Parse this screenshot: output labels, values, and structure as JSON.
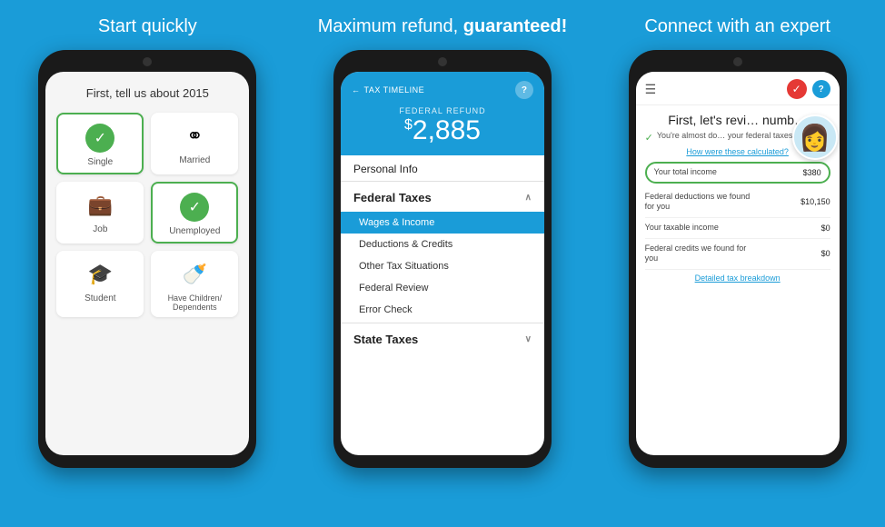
{
  "columns": [
    {
      "id": "col1",
      "title_plain": "Start quickly",
      "title_bold": "",
      "phone": {
        "header_text": "First, tell us about 2015",
        "cards": [
          {
            "id": "single",
            "label": "Single",
            "type": "check",
            "selected": true
          },
          {
            "id": "married",
            "label": "Married",
            "type": "rings",
            "selected": false
          },
          {
            "id": "job",
            "label": "Job",
            "type": "briefcase",
            "selected": false
          },
          {
            "id": "unemployed",
            "label": "Unemployed",
            "type": "check",
            "selected": true
          },
          {
            "id": "student",
            "label": "Student",
            "type": "grad",
            "selected": false
          },
          {
            "id": "children",
            "label": "Have Children/\nDependents",
            "type": "stroller",
            "selected": false
          }
        ]
      }
    },
    {
      "id": "col2",
      "title_plain": "Maximum refund, ",
      "title_bold": "guaranteed!",
      "phone": {
        "nav_back": "TAX TIMELINE",
        "help_label": "?",
        "refund_label": "FEDERAL REFUND",
        "refund_symbol": "$",
        "refund_amount": "2,885",
        "sections": [
          {
            "type": "item",
            "label": "Personal Info",
            "active": false,
            "sub": false
          },
          {
            "type": "section-header",
            "label": "Federal Taxes",
            "expanded": true
          },
          {
            "type": "sub-item",
            "label": "Wages & Income",
            "active": true
          },
          {
            "type": "sub-item",
            "label": "Deductions & Credits",
            "active": false
          },
          {
            "type": "sub-item",
            "label": "Other Tax Situations",
            "active": false
          },
          {
            "type": "sub-item",
            "label": "Federal Review",
            "active": false
          },
          {
            "type": "sub-item",
            "label": "Error Check",
            "active": false
          },
          {
            "type": "section-header",
            "label": "State Taxes",
            "expanded": false
          }
        ]
      }
    },
    {
      "id": "col3",
      "title_plain": "Connect with an expert",
      "title_bold": "",
      "phone": {
        "review_title": "First, let's revi… numb…",
        "almost_done_text": "You're almost do… your federal taxes fo… ar.",
        "how_calculated": "How were these calculated?",
        "rows": [
          {
            "label": "Your total income",
            "value": "$380",
            "highlighted": true
          },
          {
            "label": "Federal deductions we found for you",
            "value": "$10,150",
            "highlighted": false
          },
          {
            "label": "Your taxable income",
            "value": "$0",
            "highlighted": false
          },
          {
            "label": "Federal credits we found for you",
            "value": "$0",
            "highlighted": false
          }
        ],
        "detailed_link": "Detailed tax breakdown"
      }
    }
  ]
}
